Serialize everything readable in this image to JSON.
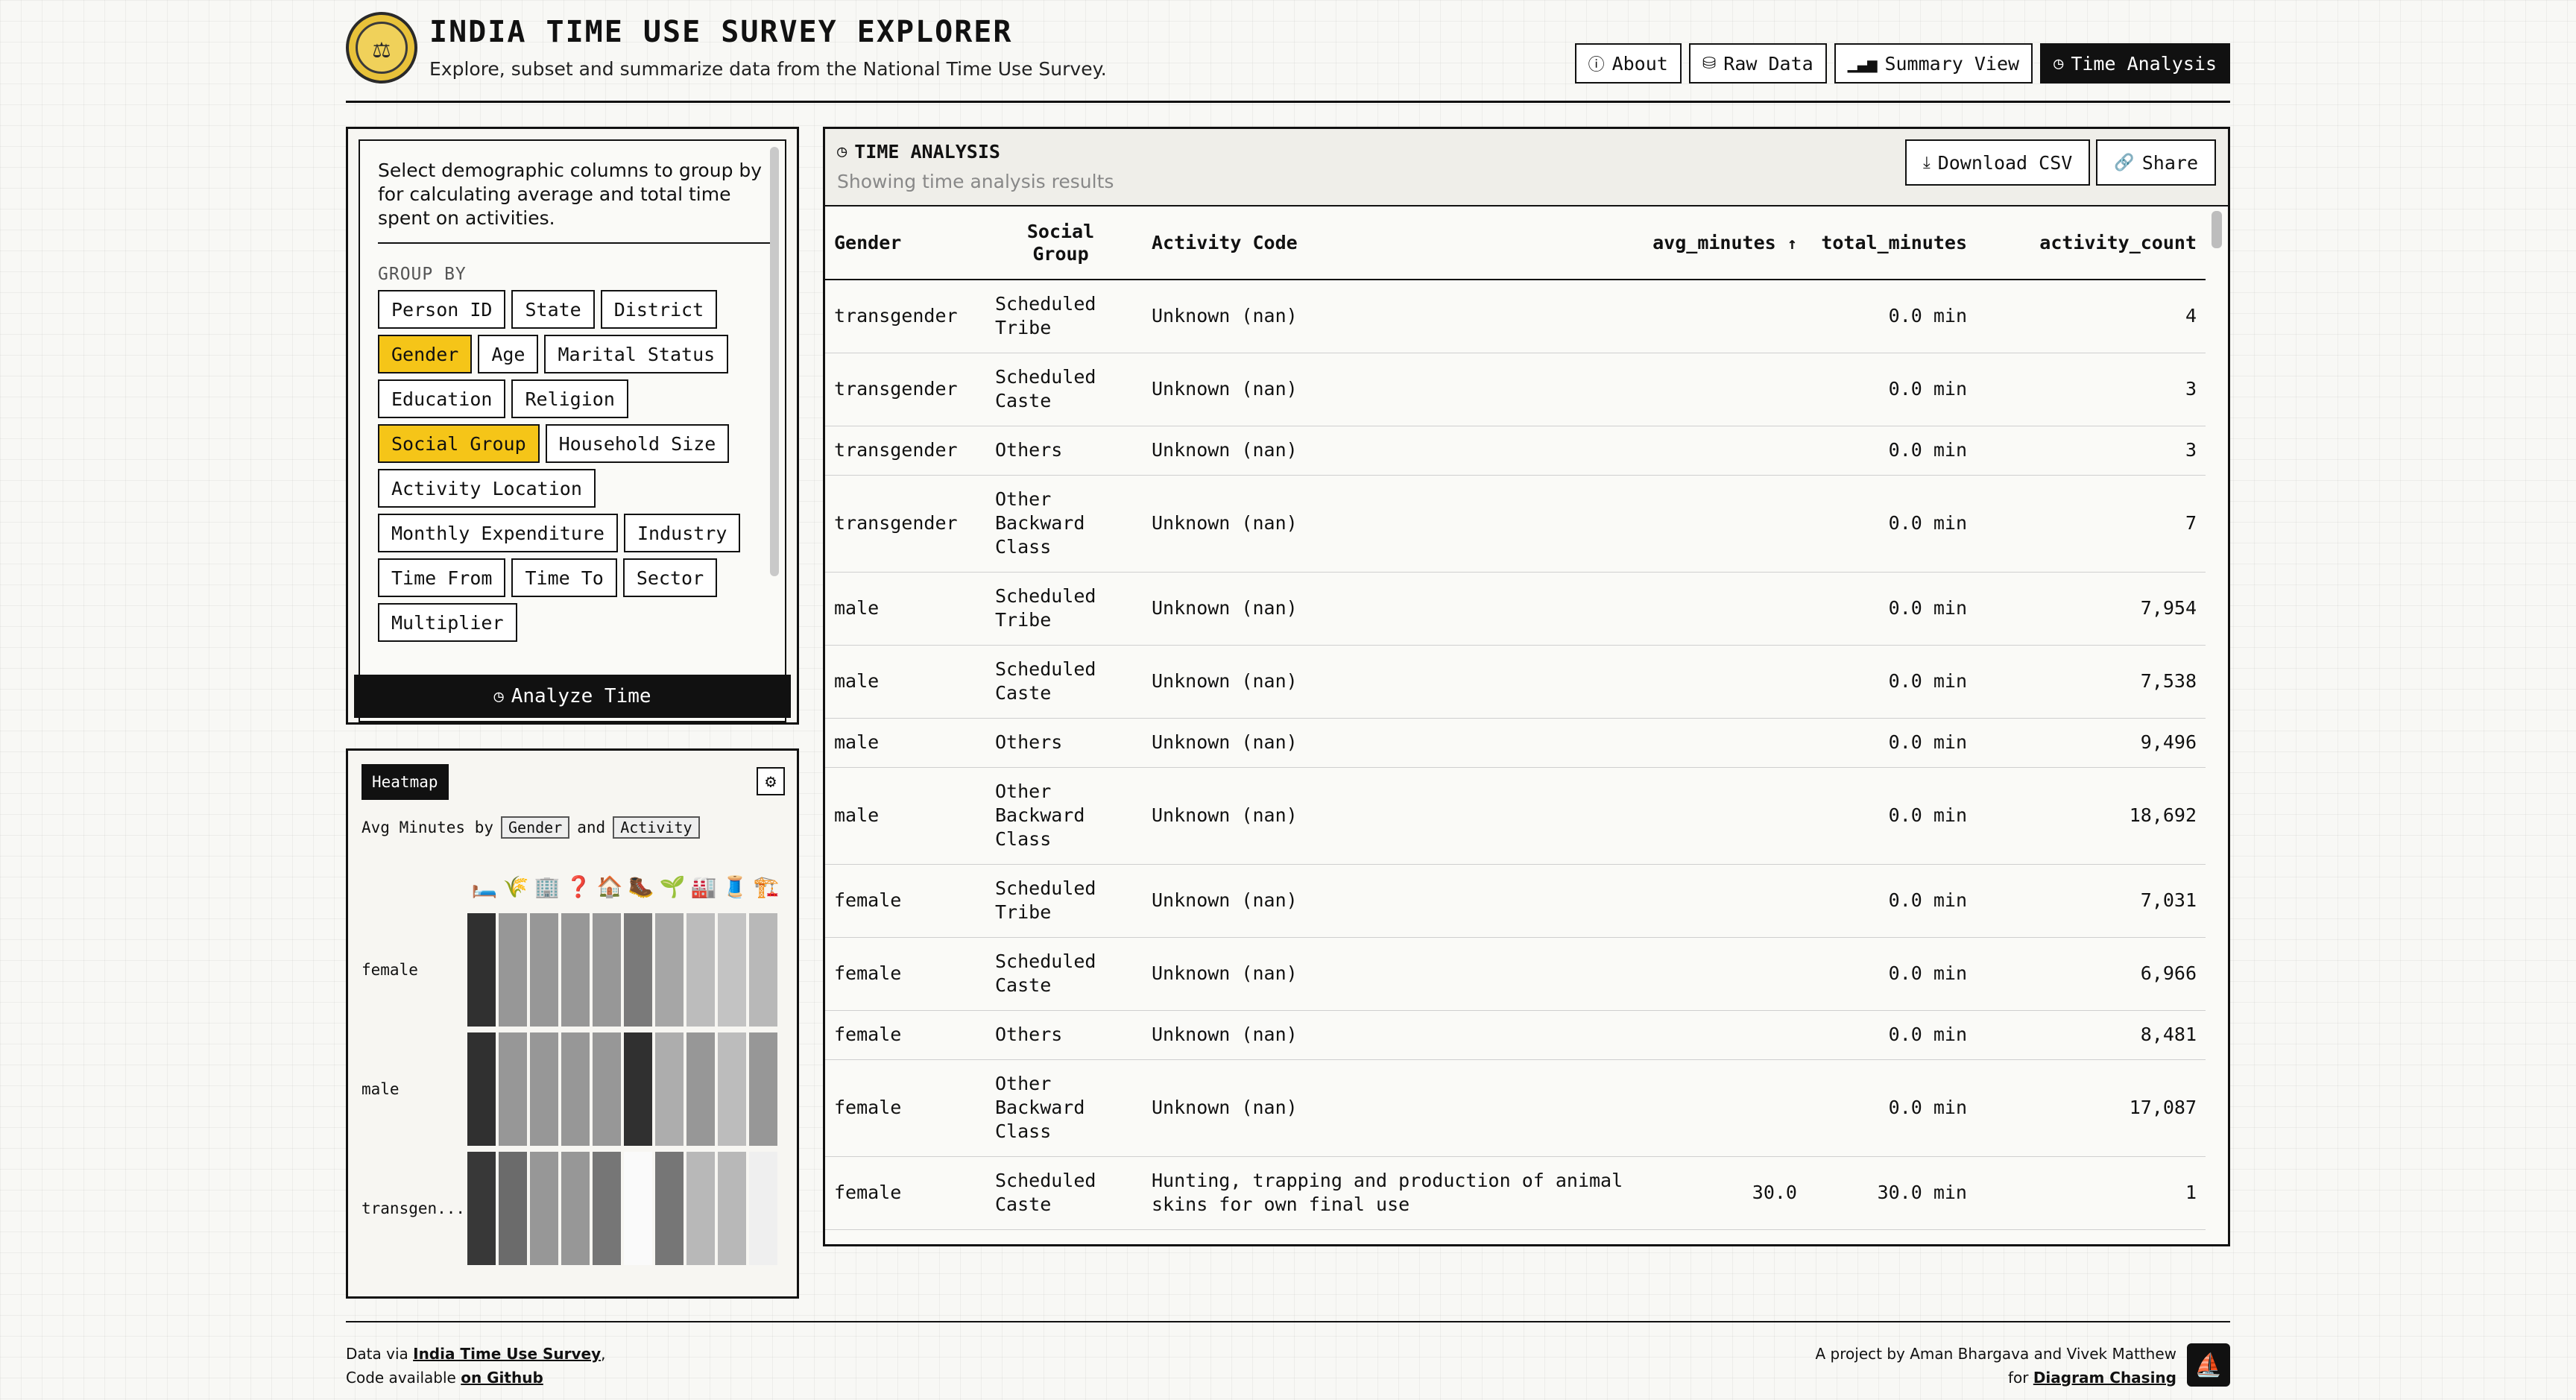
{
  "header": {
    "title": "INDIA TIME USE SURVEY EXPLORER",
    "subtitle": "Explore, subset and summarize data from the National Time Use Survey.",
    "nav": [
      {
        "label": "About",
        "icon": "info-icon",
        "active": false
      },
      {
        "label": "Raw Data",
        "icon": "database-icon",
        "active": false
      },
      {
        "label": "Summary View",
        "icon": "bar-chart-icon",
        "active": false
      },
      {
        "label": "Time Analysis",
        "icon": "clock-icon",
        "active": true
      }
    ]
  },
  "groupby": {
    "intro": "Select demographic columns to group by for calculating average and total time spent on activities.",
    "label": "GROUP BY",
    "chips": [
      {
        "label": "Person ID",
        "selected": false
      },
      {
        "label": "State",
        "selected": false
      },
      {
        "label": "District",
        "selected": false
      },
      {
        "label": "Gender",
        "selected": true
      },
      {
        "label": "Age",
        "selected": false
      },
      {
        "label": "Marital Status",
        "selected": false
      },
      {
        "label": "Education",
        "selected": false
      },
      {
        "label": "Religion",
        "selected": false
      },
      {
        "label": "Social Group",
        "selected": true
      },
      {
        "label": "Household Size",
        "selected": false
      },
      {
        "label": "Activity Location",
        "selected": false
      },
      {
        "label": "Monthly Expenditure",
        "selected": false
      },
      {
        "label": "Industry",
        "selected": false
      },
      {
        "label": "Time From",
        "selected": false
      },
      {
        "label": "Time To",
        "selected": false
      },
      {
        "label": "Sector",
        "selected": false
      },
      {
        "label": "Multiplier",
        "selected": false
      }
    ],
    "analyze_label": "Analyze Time"
  },
  "heatmap": {
    "tag": "Heatmap",
    "desc_prefix": "Avg Minutes by",
    "desc_dim1": "Gender",
    "desc_and": "and",
    "desc_dim2": "Activity",
    "activity_icons": [
      "🛏️",
      "🌾",
      "🏢",
      "❓",
      "🏠",
      "🥾",
      "🌱",
      "🏭",
      "🧵",
      "🏗️"
    ],
    "rows": [
      {
        "label": "female",
        "levels": [
          0.92,
          0.45,
          0.45,
          0.45,
          0.45,
          0.58,
          0.38,
          0.28,
          0.25,
          0.3
        ]
      },
      {
        "label": "male",
        "levels": [
          0.92,
          0.45,
          0.45,
          0.45,
          0.45,
          0.92,
          0.35,
          0.45,
          0.28,
          0.45
        ]
      },
      {
        "label": "transgen...",
        "levels": [
          0.88,
          0.65,
          0.45,
          0.45,
          0.6,
          0.0,
          0.6,
          0.3,
          0.3,
          0.05
        ]
      }
    ]
  },
  "results": {
    "title": "TIME ANALYSIS",
    "subtitle": "Showing time analysis results",
    "download_label": "Download CSV",
    "share_label": "Share",
    "columns": [
      "Gender",
      "Social Group",
      "Activity Code",
      "avg_minutes",
      "total_minutes",
      "activity_count"
    ],
    "sort_indicator": "↑",
    "rows": [
      [
        "transgender",
        "Scheduled Tribe",
        "Unknown (nan)",
        "",
        "0.0 min",
        "4"
      ],
      [
        "transgender",
        "Scheduled Caste",
        "Unknown (nan)",
        "",
        "0.0 min",
        "3"
      ],
      [
        "transgender",
        "Others",
        "Unknown (nan)",
        "",
        "0.0 min",
        "3"
      ],
      [
        "transgender",
        "Other Backward Class",
        "Unknown (nan)",
        "",
        "0.0 min",
        "7"
      ],
      [
        "male",
        "Scheduled Tribe",
        "Unknown (nan)",
        "",
        "0.0 min",
        "7,954"
      ],
      [
        "male",
        "Scheduled Caste",
        "Unknown (nan)",
        "",
        "0.0 min",
        "7,538"
      ],
      [
        "male",
        "Others",
        "Unknown (nan)",
        "",
        "0.0 min",
        "9,496"
      ],
      [
        "male",
        "Other Backward Class",
        "Unknown (nan)",
        "",
        "0.0 min",
        "18,692"
      ],
      [
        "female",
        "Scheduled Tribe",
        "Unknown (nan)",
        "",
        "0.0 min",
        "7,031"
      ],
      [
        "female",
        "Scheduled Caste",
        "Unknown (nan)",
        "",
        "0.0 min",
        "6,966"
      ],
      [
        "female",
        "Others",
        "Unknown (nan)",
        "",
        "0.0 min",
        "8,481"
      ],
      [
        "female",
        "Other Backward Class",
        "Unknown (nan)",
        "",
        "0.0 min",
        "17,087"
      ],
      [
        "female",
        "Scheduled Caste",
        "Hunting, trapping and production of animal skins for own final use",
        "30.0",
        "30.0 min",
        "1"
      ]
    ]
  },
  "footer": {
    "data_via_prefix": "Data via",
    "data_via_link": "India Time Use Survey",
    "code_prefix": "Code available",
    "code_link": "on Github",
    "project_by": "A project by Aman Bhargava and Vivek Matthew",
    "for_prefix": "for",
    "for_link": "Diagram Chasing"
  }
}
